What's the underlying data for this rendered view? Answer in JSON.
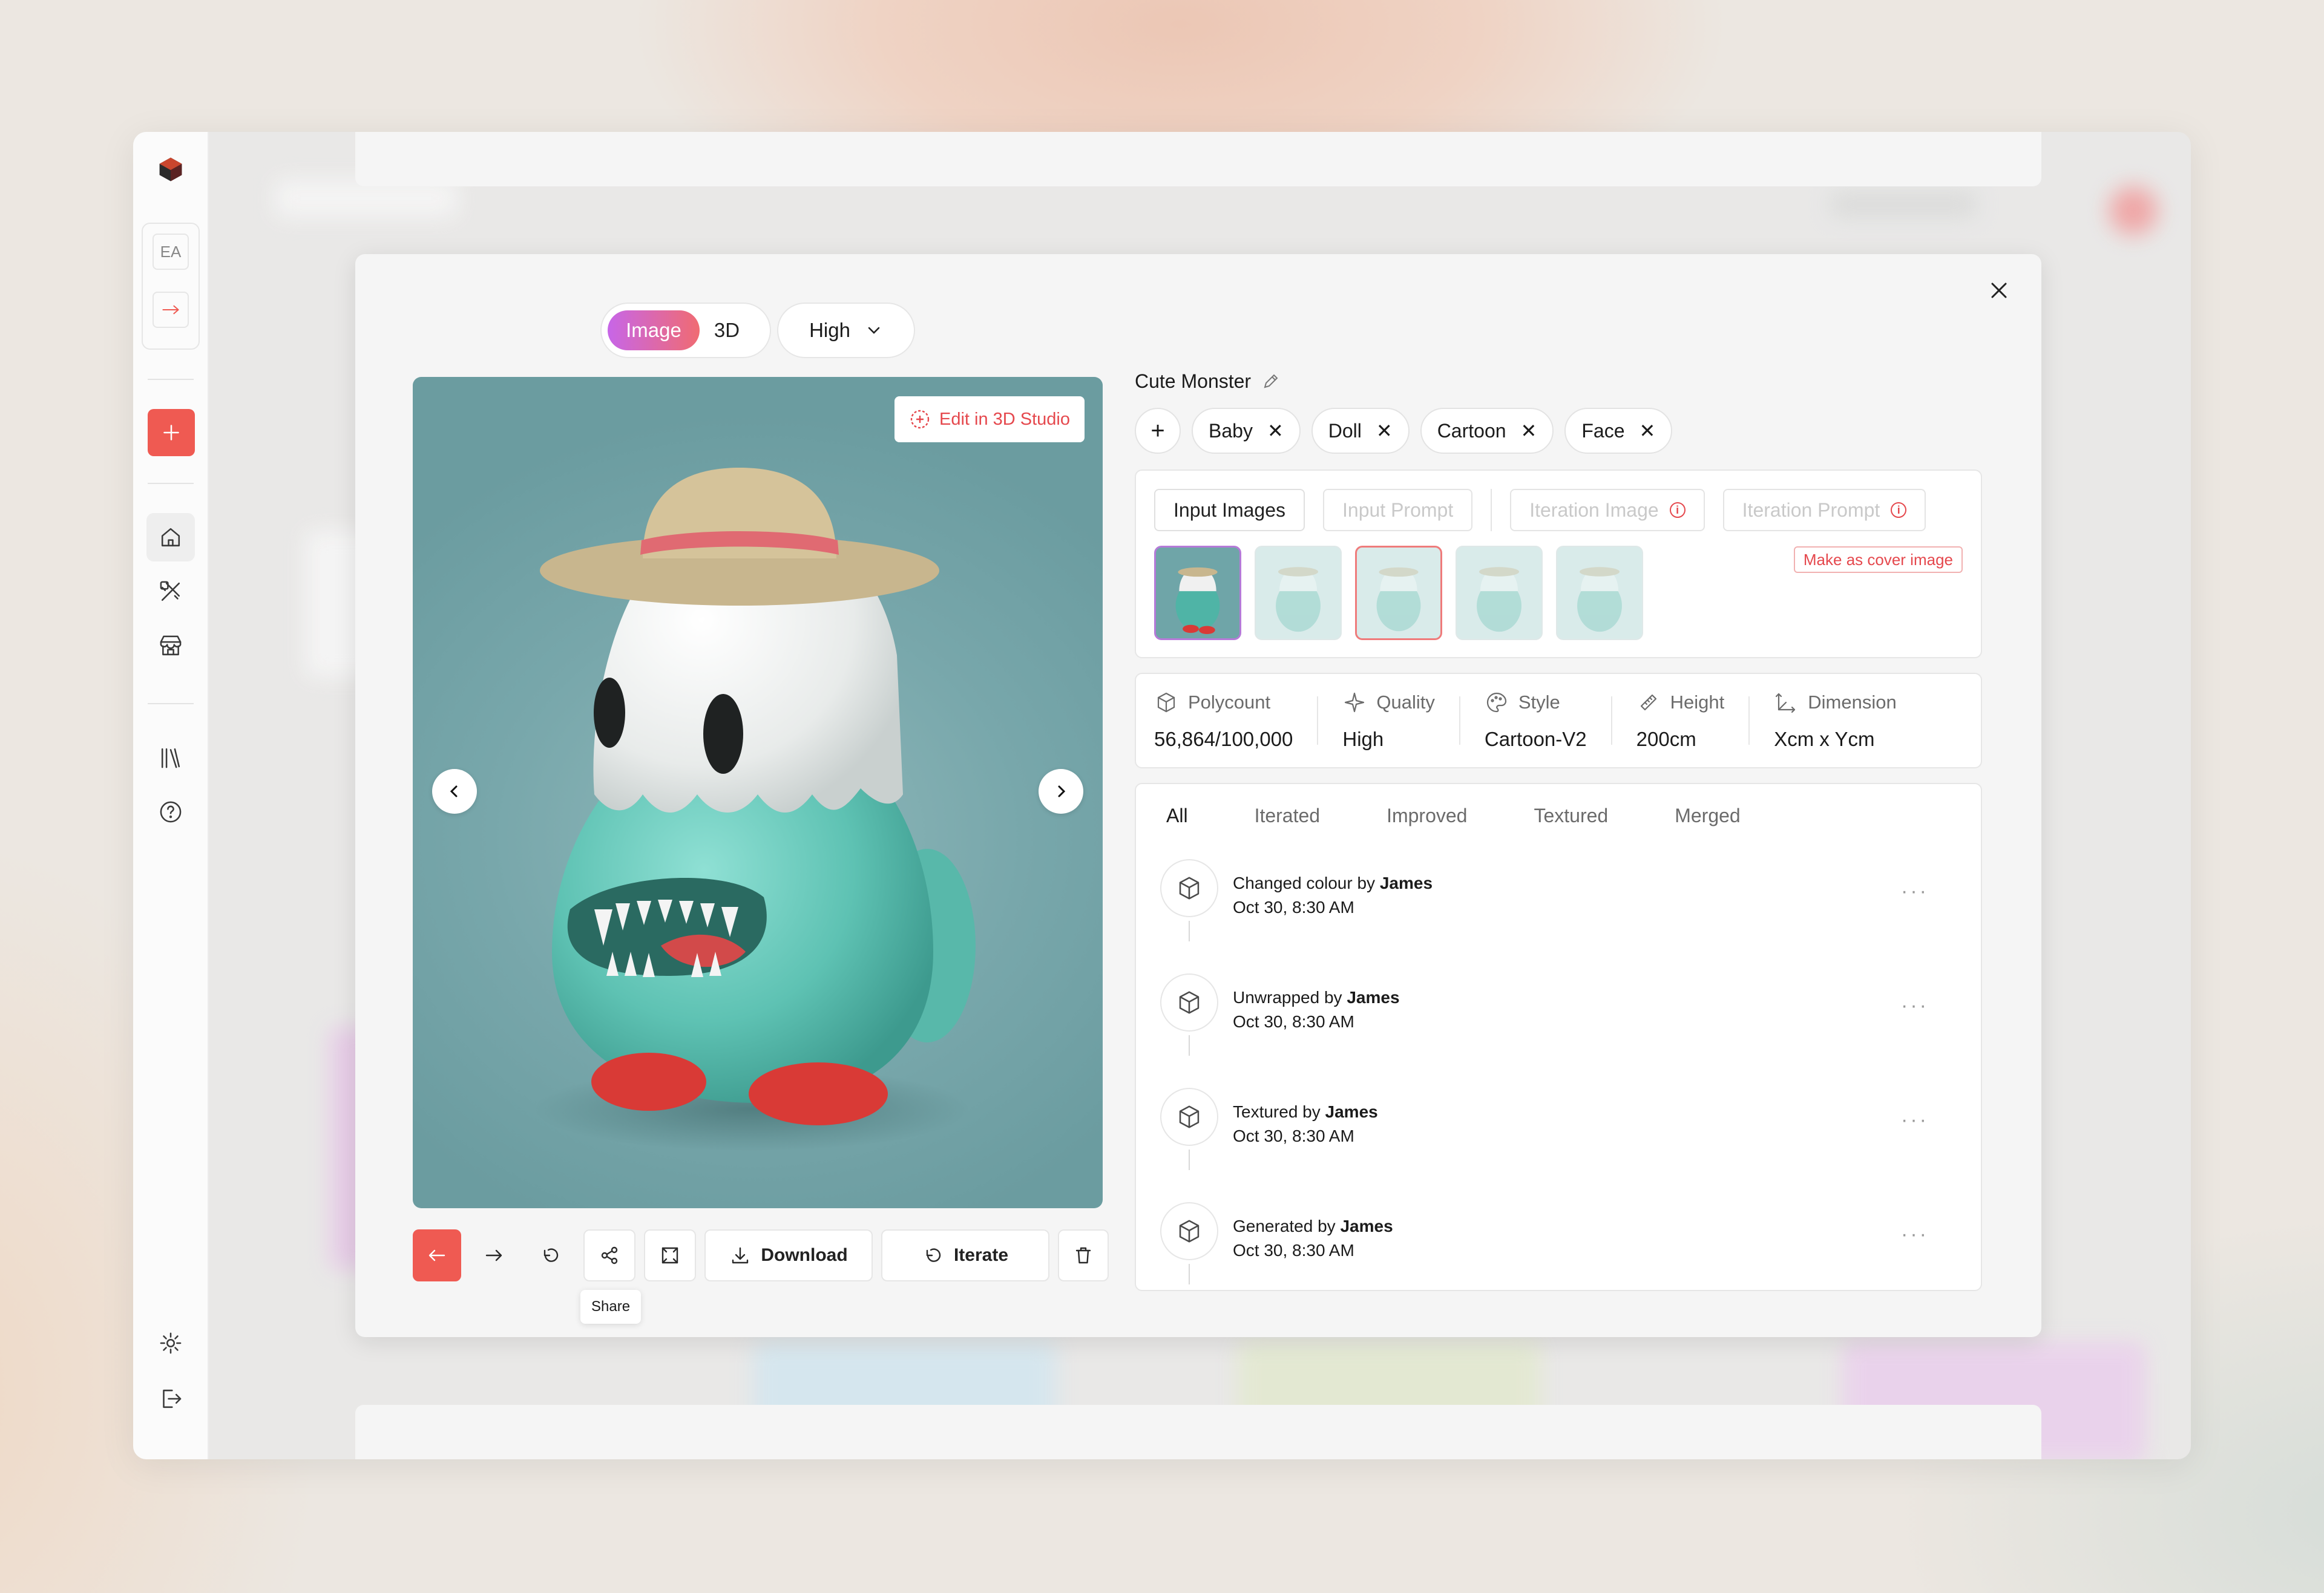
{
  "sidebar": {
    "workspace_initials": "EA",
    "new_label": "+"
  },
  "modal": {
    "mode_tabs": [
      "Image",
      "3D"
    ],
    "quality_select": "High",
    "edit_in_studio": "Edit in 3D Studio",
    "toolbar": {
      "download": "Download",
      "iterate": "Iterate",
      "share_tooltip": "Share"
    },
    "asset": {
      "title": "Cute Monster",
      "tags": [
        "Baby",
        "Doll",
        "Cartoon",
        "Face"
      ],
      "input_tabs": [
        "Input Images",
        "Input Prompt",
        "Iteration Image",
        "Iteration Prompt"
      ],
      "cover_button": "Make as cover image",
      "stats": [
        {
          "label": "Polycount",
          "value": "56,864/100,000",
          "icon": "cube-icon"
        },
        {
          "label": "Quality",
          "value": "High",
          "icon": "sparkle-icon"
        },
        {
          "label": "Style",
          "value": "Cartoon-V2",
          "icon": "palette-icon"
        },
        {
          "label": "Height",
          "value": "200cm",
          "icon": "ruler-icon"
        },
        {
          "label": "Dimension",
          "value": "Xcm x Ycm",
          "icon": "dimension-icon"
        }
      ],
      "history_tabs": [
        "All",
        "Iterated",
        "Improved",
        "Textured",
        "Merged"
      ],
      "history": [
        {
          "action": "Changed colour by",
          "user": "James",
          "time": "Oct 30, 8:30 AM"
        },
        {
          "action": "Unwrapped by",
          "user": "James",
          "time": "Oct 30, 8:30 AM"
        },
        {
          "action": "Textured by",
          "user": "James",
          "time": "Oct 30, 8:30 AM"
        },
        {
          "action": "Generated by",
          "user": "James",
          "time": "Oct 30, 8:30 AM"
        }
      ]
    }
  },
  "colors": {
    "accent": "#ef5a52",
    "gradient_start": "#c766e8",
    "gradient_end": "#f06b72"
  }
}
